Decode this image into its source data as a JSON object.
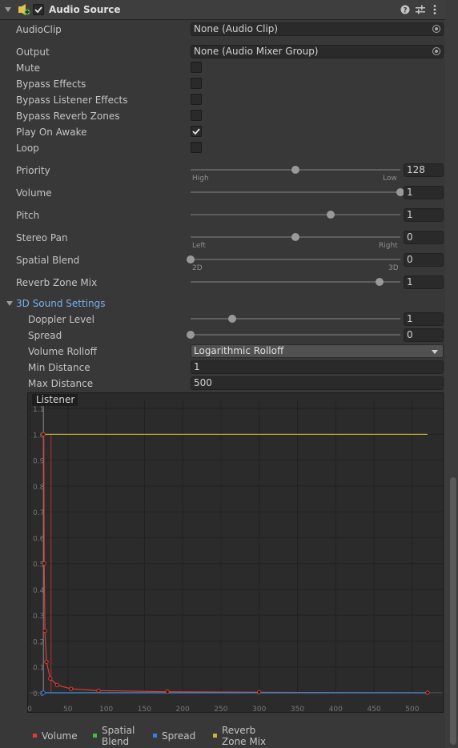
{
  "component": {
    "title": "Audio Source"
  },
  "fields": {
    "audioclip": {
      "label": "AudioClip",
      "value": "None (Audio Clip)"
    },
    "output": {
      "label": "Output",
      "value": "None (Audio Mixer Group)"
    }
  },
  "toggles": [
    {
      "label": "Mute",
      "checked": false
    },
    {
      "label": "Bypass Effects",
      "checked": false
    },
    {
      "label": "Bypass Listener Effects",
      "checked": false
    },
    {
      "label": "Bypass Reverb Zones",
      "checked": false
    },
    {
      "label": "Play On Awake",
      "checked": true
    },
    {
      "label": "Loop",
      "checked": false
    }
  ],
  "sliders": {
    "priority": {
      "label": "Priority",
      "value": "128",
      "level": 0.5,
      "left": "High",
      "right": "Low"
    },
    "volume": {
      "label": "Volume",
      "value": "1",
      "level": 1.0
    },
    "pitch": {
      "label": "Pitch",
      "value": "1",
      "level": 0.667
    },
    "stereo_pan": {
      "label": "Stereo Pan",
      "value": "0",
      "level": 0.5,
      "left": "Left",
      "right": "Right"
    },
    "spatial_blend": {
      "label": "Spatial Blend",
      "value": "0",
      "level": 0.0,
      "left": "2D",
      "right": "3D"
    },
    "reverb_zone_mix": {
      "label": "Reverb Zone Mix",
      "value": "1",
      "level": 0.9
    }
  },
  "sound3d": {
    "section_label": "3D Sound Settings",
    "doppler": {
      "label": "Doppler Level",
      "value": "1",
      "level": 0.2
    },
    "spread": {
      "label": "Spread",
      "value": "0",
      "level": 0.0
    },
    "rolloff": {
      "label": "Volume Rolloff",
      "value": "Logarithmic Rolloff"
    },
    "min_distance": {
      "label": "Min Distance",
      "value": "1"
    },
    "max_distance": {
      "label": "Max Distance",
      "value": "500"
    }
  },
  "graph": {
    "badge": "Listener"
  },
  "legend": [
    {
      "label": "Volume",
      "color": "#e03b35"
    },
    {
      "label": "Spatial Blend",
      "color": "#3fbf3f"
    },
    {
      "label": "Spread",
      "color": "#3b7de0"
    },
    {
      "label": "Reverb Zone Mix",
      "color": "#c8b63c"
    }
  ],
  "chart_data": {
    "type": "line",
    "xlim": [
      0,
      520
    ],
    "ylim": [
      0,
      1.1
    ],
    "x_ticks": [
      "0",
      "50",
      "100",
      "150",
      "200",
      "250",
      "300",
      "350",
      "400",
      "450",
      "500"
    ],
    "y_ticks": [
      "0.0",
      "0.1",
      "0.2",
      "0.3",
      "0.4",
      "0.5",
      "0.6",
      "0.7",
      "0.8",
      "0.9",
      "1.0",
      "1.1"
    ],
    "listener_x": 18,
    "series": [
      {
        "name": "Volume",
        "color": "#e03b35",
        "x": [
          18,
          18.5,
          19,
          20,
          22,
          27,
          36,
          54,
          90,
          180,
          300,
          520
        ],
        "y": [
          1.0,
          0.98,
          0.5,
          0.24,
          0.12,
          0.055,
          0.03,
          0.015,
          0.008,
          0.004,
          0.002,
          0.0
        ]
      },
      {
        "name": "Spatial Blend",
        "color": "#3fbf3f",
        "x": [
          18,
          520
        ],
        "y": [
          0,
          0
        ]
      },
      {
        "name": "Spread",
        "color": "#3b7de0",
        "x": [
          18,
          520
        ],
        "y": [
          0,
          0
        ]
      },
      {
        "name": "Reverb Zone Mix",
        "color": "#c8b63c",
        "x": [
          18,
          520
        ],
        "y": [
          1.0,
          1.0
        ]
      }
    ]
  }
}
